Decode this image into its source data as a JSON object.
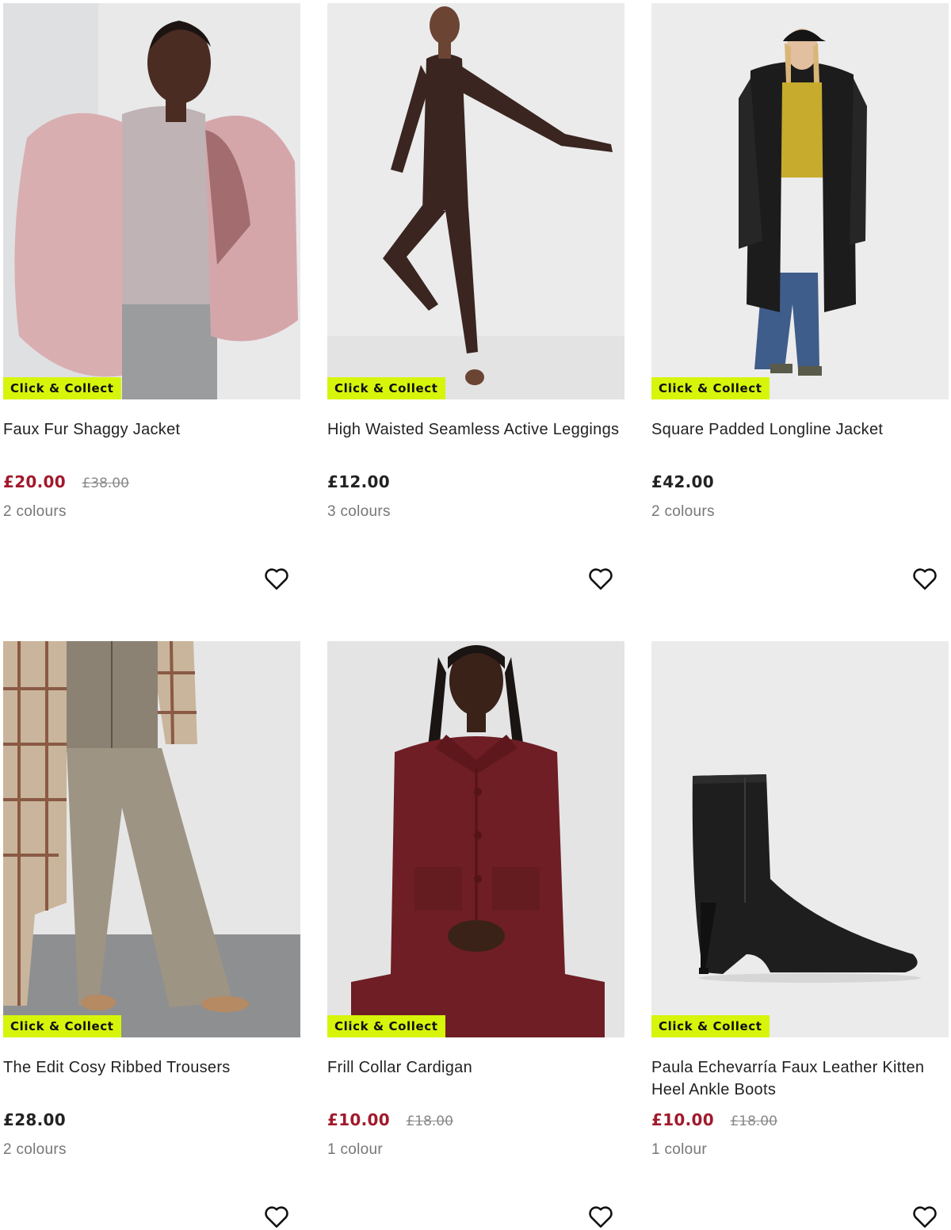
{
  "products": [
    {
      "title": "Faux Fur Shaggy Jacket",
      "price": "£20.00",
      "was_price": "£38.00",
      "on_sale": true,
      "colours": "2 colours",
      "badge": "Click & Collect",
      "image_desc": "model in pink faux fur jacket",
      "icon": "heart-outline-icon"
    },
    {
      "title": "High Waisted Seamless Active Leggings",
      "price": "£12.00",
      "was_price": "",
      "on_sale": false,
      "colours": "3 colours",
      "badge": "Click & Collect",
      "image_desc": "model in brown active set",
      "icon": "heart-outline-icon"
    },
    {
      "title": "Square Padded Longline Jacket",
      "price": "£42.00",
      "was_price": "",
      "on_sale": false,
      "colours": "2 colours",
      "badge": "Click & Collect",
      "image_desc": "model in black padded longline coat",
      "icon": "heart-outline-icon"
    },
    {
      "title": "The Edit Cosy Ribbed Trousers",
      "price": "£28.00",
      "was_price": "",
      "on_sale": false,
      "colours": "2 colours",
      "badge": "Click & Collect",
      "image_desc": "model in taupe ribbed knit trousers",
      "icon": "heart-outline-icon"
    },
    {
      "title": "Frill Collar Cardigan",
      "price": "£10.00",
      "was_price": "£18.00",
      "on_sale": true,
      "colours": "1 colour",
      "badge": "Click & Collect",
      "image_desc": "model in burgundy frill collar cardigan",
      "icon": "heart-outline-icon"
    },
    {
      "title": "Paula Echevarría Faux Leather Kitten Heel Ankle Boots",
      "price": "£10.00",
      "was_price": "£18.00",
      "on_sale": true,
      "colours": "1 colour",
      "badge": "Click & Collect",
      "image_desc": "black faux leather kitten heel ankle boot",
      "icon": "heart-outline-icon"
    }
  ],
  "colors": {
    "sale_price": "#a1192b",
    "badge_bg": "#d6f50a",
    "text": "#222222",
    "muted": "#777777"
  }
}
